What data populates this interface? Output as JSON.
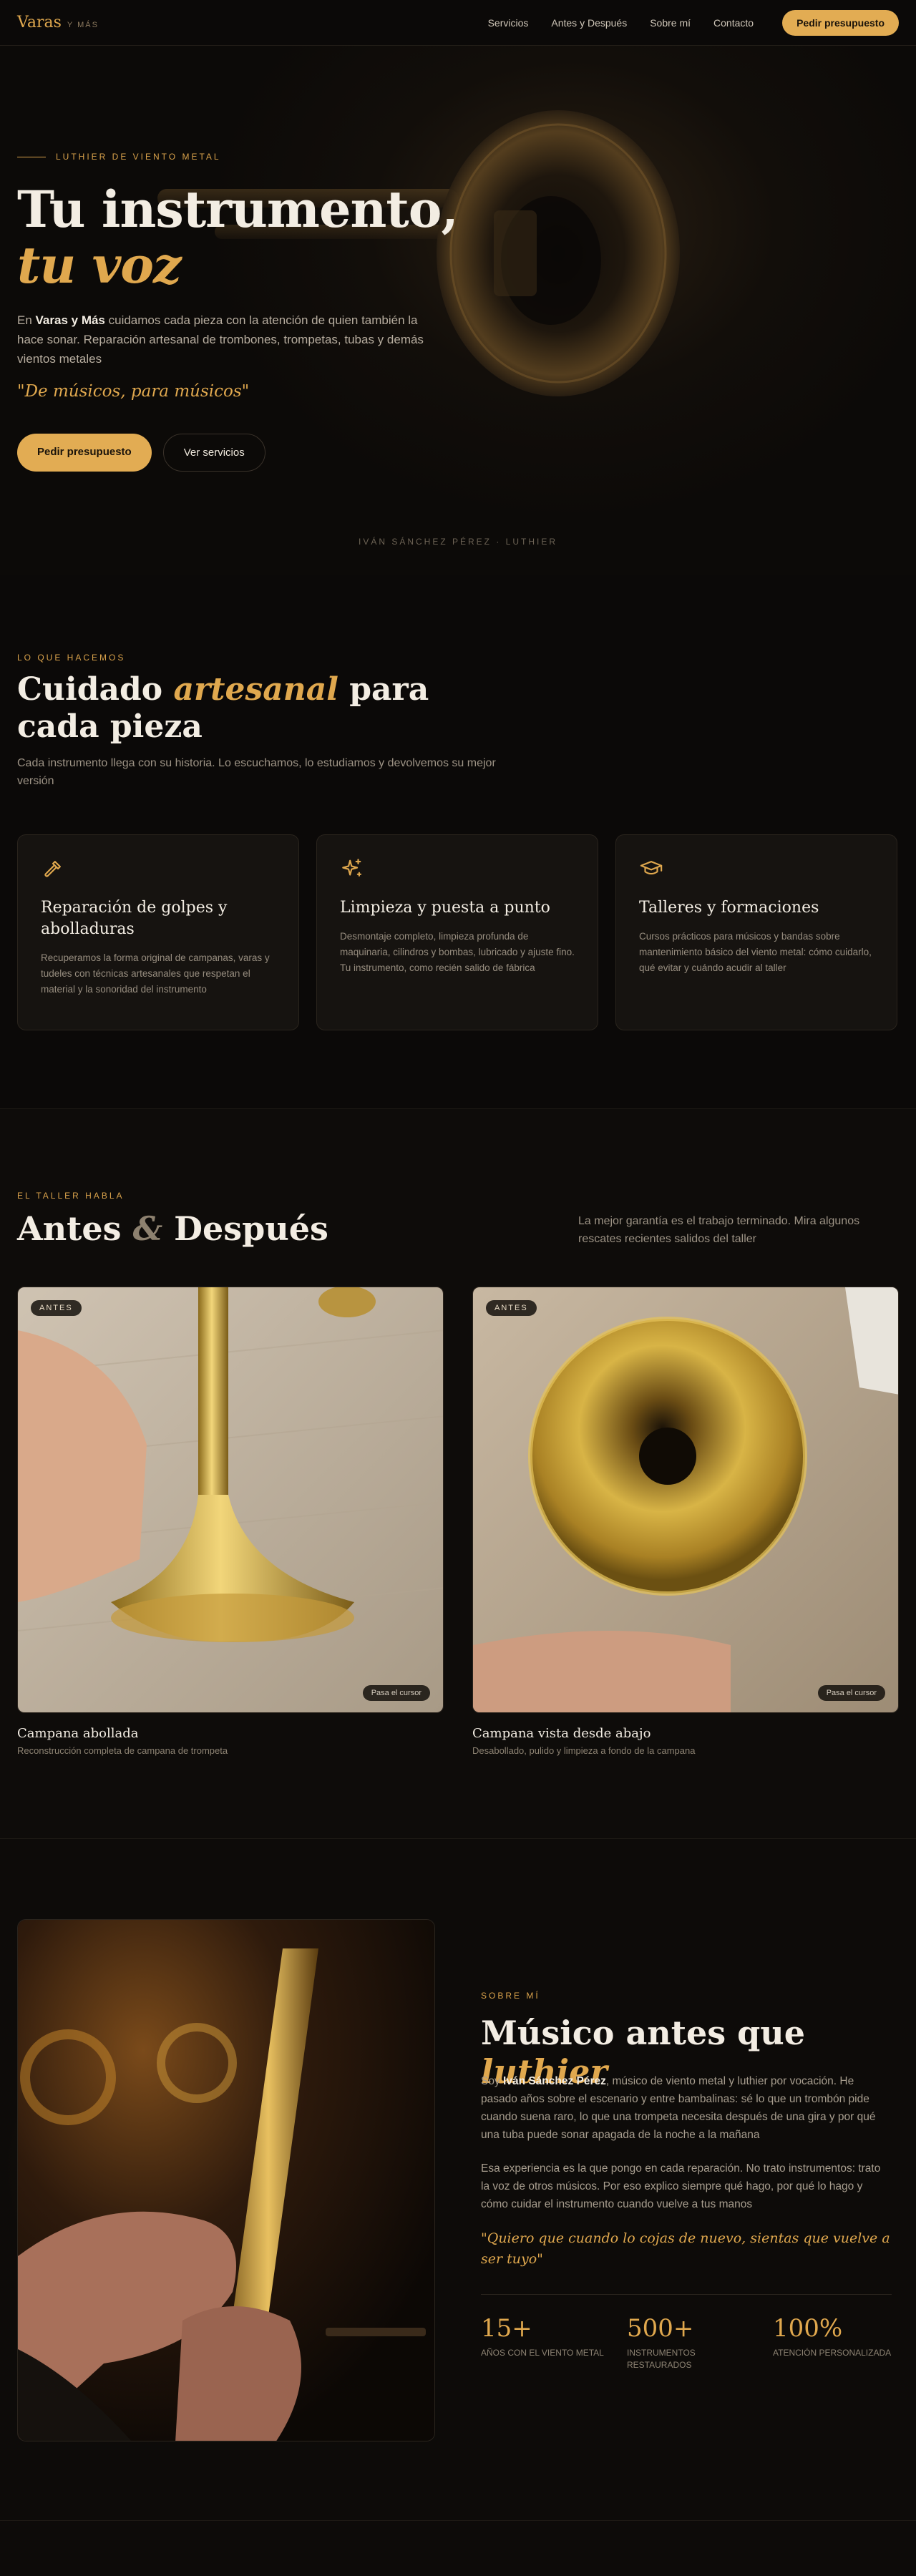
{
  "nav": {
    "logo_main": "Varas",
    "logo_sub": "Y MÁS",
    "links": [
      "Servicios",
      "Antes y Después",
      "Sobre mí",
      "Contacto"
    ],
    "cta": "Pedir presupuesto"
  },
  "hero": {
    "kicker": "LUTHIER DE VIENTO METAL",
    "title_line1": "Tu instrumento,",
    "title_line2": "tu voz",
    "desc_prefix": "En ",
    "desc_brand": "Varas y Más",
    "desc_rest": " cuidamos cada pieza con la atención de quien también la hace sonar. Reparación artesanal de trombones, trompetas, tubas y demás vientos metales",
    "quote": "\"De músicos, para músicos\"",
    "btn_primary": "Pedir presupuesto",
    "btn_secondary": "Ver servicios",
    "signature": "IVÁN SÁNCHEZ PÉREZ · LUTHIER"
  },
  "services": {
    "kicker": "LO QUE HACEMOS",
    "title_a": "Cuidado ",
    "title_em": "artesanal",
    "title_b": " para cada pieza",
    "subtitle": "Cada instrumento llega con su historia. Lo escuchamos, lo estudiamos y devolvemos su mejor versión",
    "cards": [
      {
        "icon": "hammer-icon",
        "title": "Reparación de golpes y abolladuras",
        "text": "Recuperamos la forma original de campanas, varas y tudeles con técnicas artesanales que respetan el material y la sonoridad del instrumento"
      },
      {
        "icon": "sparkles-icon",
        "title": "Limpieza y puesta a punto",
        "text": "Desmontaje completo, limpieza profunda de maquinaria, cilindros y bombas, lubricado y ajuste fino. Tu instrumento, como recién salido de fábrica"
      },
      {
        "icon": "graduation-cap-icon",
        "title": "Talleres y formaciones",
        "text": "Cursos prácticos para músicos y bandas sobre mantenimiento básico del viento metal: cómo cuidarlo, qué evitar y cuándo acudir al taller"
      }
    ]
  },
  "before_after": {
    "kicker": "EL TALLER HABLA",
    "title_a": "Antes ",
    "title_amp": "&",
    "title_b": " Después",
    "side_text": "La mejor garantía es el trabajo terminado. Mira algunos rescates recientes salidos del taller",
    "items": [
      {
        "badge": "ANTES",
        "hint": "Pasa el cursor",
        "caption": "Campana abollada",
        "sub": "Reconstrucción completa de campana de trompeta"
      },
      {
        "badge": "ANTES",
        "hint": "Pasa el cursor",
        "caption": "Campana vista desde abajo",
        "sub": "Desabollado, pulido y limpieza a fondo de la campana"
      }
    ]
  },
  "about": {
    "kicker": "SOBRE MÍ",
    "title_a": "Músico antes que ",
    "title_em": "luthier",
    "p1_prefix": "Soy ",
    "p1_name": "Iván Sánchez Pérez",
    "p1_rest": ", músico de viento metal y luthier por vocación. He pasado años sobre el escenario y entre bambalinas: sé lo que un trombón pide cuando suena raro, lo que una trompeta necesita después de una gira y por qué una tuba puede sonar apagada de la noche a la mañana",
    "p2": "Esa experiencia es la que pongo en cada reparación. No trato instrumentos: trato la voz de otros músicos. Por eso explico siempre qué hago, por qué lo hago y cómo cuidar el instrumento cuando vuelve a tus manos",
    "quote": "\"Quiero que cuando lo cojas de nuevo, sientas que vuelve a ser tuyo\"",
    "stats": [
      {
        "num": "15+",
        "label": "AÑOS CON EL VIENTO METAL"
      },
      {
        "num": "500+",
        "label": "INSTRUMENTOS RESTAURADOS"
      },
      {
        "num": "100%",
        "label": "ATENCIÓN PERSONALIZADA"
      }
    ]
  },
  "colors": {
    "accent": "#e2ac53",
    "background": "#0d0b09",
    "card": "#161310"
  }
}
